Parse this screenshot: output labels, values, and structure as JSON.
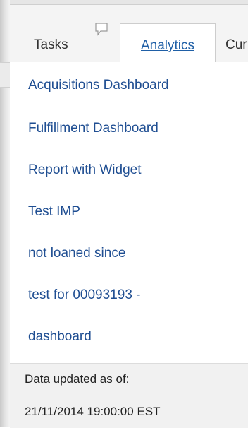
{
  "tabs": {
    "tasks": "Tasks",
    "analytics": "Analytics",
    "next": "Cur"
  },
  "menu": {
    "items": [
      "Acquisitions Dashboard",
      "Fulfillment Dashboard",
      "Report with Widget",
      "Test IMP",
      "not loaned since",
      "test for 00093193 -",
      "dashboard"
    ]
  },
  "footer": {
    "label": "Data updated as of:",
    "timestamp": "21/11/2014 19:00:00 EST"
  },
  "icons": {
    "comment": "comment-bubble-icon"
  },
  "colors": {
    "link": "#1f4e92",
    "active_tab": "#1f5fa6",
    "footer_bg": "#f1f1f1"
  }
}
